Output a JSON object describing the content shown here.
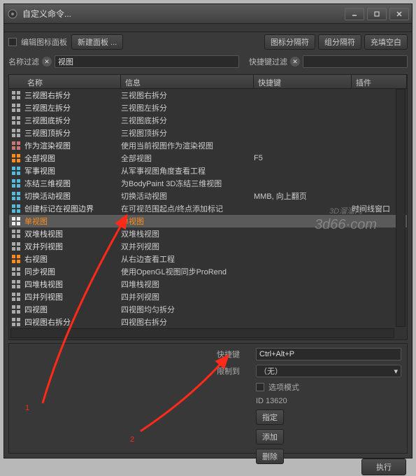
{
  "window": {
    "title": "自定义命令..."
  },
  "toolbar": {
    "edit_icon_panel": "编辑图标面板",
    "new_panel": "新建面板 ...",
    "icon_separator": "图标分隔符",
    "group_separator": "组分隔符",
    "fill_blank": "充填空白"
  },
  "filters": {
    "name_label": "名称过滤",
    "name_value": "视图",
    "shortcut_label": "快捷键过滤",
    "shortcut_value": ""
  },
  "columns": {
    "name": "名称",
    "info": "信息",
    "shortcut": "快捷键",
    "plugin": "插件"
  },
  "rows": [
    {
      "name": "三视图右拆分",
      "info": "三视图右拆分",
      "key": "",
      "plugin": ""
    },
    {
      "name": "三视图左拆分",
      "info": "三视图左拆分",
      "key": "",
      "plugin": ""
    },
    {
      "name": "三视图底拆分",
      "info": "三视图底拆分",
      "key": "",
      "plugin": ""
    },
    {
      "name": "三视图顶拆分",
      "info": "三视图顶拆分",
      "key": "",
      "plugin": ""
    },
    {
      "name": "作为渲染视图",
      "info": "使用当前视图作为渲染视图",
      "key": "",
      "plugin": ""
    },
    {
      "name": "全部视图",
      "info": "全部视图",
      "key": "F5",
      "plugin": ""
    },
    {
      "name": "军事视图",
      "info": "从军事视图角度查看工程",
      "key": "",
      "plugin": ""
    },
    {
      "name": "冻结三维视图",
      "info": "为BodyPaint 3D冻结三维视图",
      "key": "",
      "plugin": ""
    },
    {
      "name": "切换活动视图",
      "info": "切换活动视图",
      "key": "MMB, 向上翻页",
      "plugin": ""
    },
    {
      "name": "创建标记在视图边界",
      "info": "在可视范围起点/终点添加标记",
      "key": "",
      "plugin": "时间线窗口"
    },
    {
      "name": "单视图",
      "info": "单视图",
      "key": "",
      "plugin": ""
    },
    {
      "name": "双堆栈视图",
      "info": "双堆栈视图",
      "key": "",
      "plugin": ""
    },
    {
      "name": "双并列视图",
      "info": "双并列视图",
      "key": "",
      "plugin": ""
    },
    {
      "name": "右视图",
      "info": "从右边查看工程",
      "key": "",
      "plugin": ""
    },
    {
      "name": "同步视图",
      "info": "使用OpenGL视图同步ProRend",
      "key": "",
      "plugin": ""
    },
    {
      "name": "四堆栈视图",
      "info": "四堆栈视图",
      "key": "",
      "plugin": ""
    },
    {
      "name": "四并列视图",
      "info": "四并列视图",
      "key": "",
      "plugin": ""
    },
    {
      "name": "四视图",
      "info": "四视图均匀拆分",
      "key": "",
      "plugin": ""
    },
    {
      "name": "四视图右拆分",
      "info": "四视图右拆分",
      "key": "",
      "plugin": ""
    }
  ],
  "selected_index": 10,
  "detail": {
    "shortcut_label": "快捷键",
    "shortcut_value": "Ctrl+Alt+P",
    "restrict_label": "限制到",
    "restrict_value": "（无）",
    "option_mode": "选项模式",
    "id_text": "ID 13620",
    "assign": "指定",
    "add": "添加",
    "delete": "删除"
  },
  "execute": "执行",
  "watermark": {
    "line1": "3D溜溜网",
    "line2": "3d66·com"
  },
  "icons": {
    "grid4": "#aaa",
    "film": "#c77",
    "orange4": "#ff8c1a",
    "globe": "#5bf",
    "render": "#5bf",
    "switch": "#5bf",
    "marker": "#5bf",
    "white": "#eee",
    "stack": "#aaa",
    "arrow": "#ff8c1a",
    "sync": "#aaa"
  }
}
